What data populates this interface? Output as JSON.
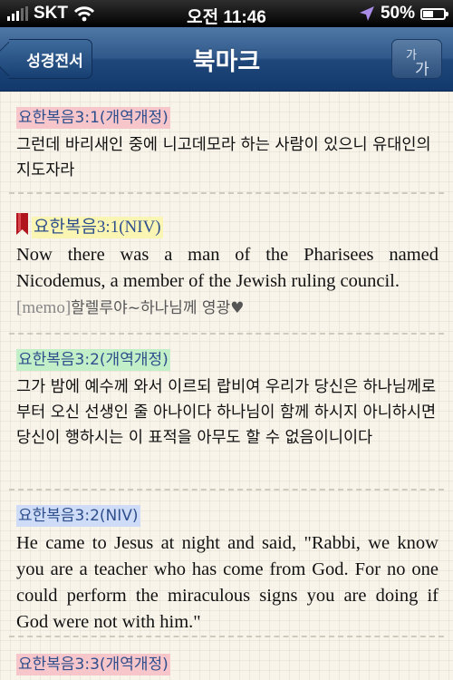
{
  "status_bar": {
    "carrier": "SKT",
    "time": "오전 11:46",
    "battery_percent": "50%",
    "battery_level": 0.5
  },
  "nav": {
    "back_label": "성경전서",
    "title": "북마크",
    "font_size_glyph_small": "가",
    "font_size_glyph_large": "가"
  },
  "entries": [
    {
      "ref": "요한복음3:1(개역개정)",
      "highlight": "#f7c6cb",
      "text": "그런데 바리새인 중에 니고데모라 하는 사람이 있으니 유대인의 지도자라"
    },
    {
      "ref": "요한복음3:1(NIV)",
      "highlight": "#fbf5b4",
      "bookmarked": true,
      "text": "Now there was a man of the Pharisees named Nicodemus, a member of the Jewish ruling council.",
      "memo_tag": "[memo]",
      "memo": "할렐루야~하나님께 영광♥"
    },
    {
      "ref": "요한복음3:2(개역개정)",
      "highlight": "#c2efc8",
      "text": "그가 밤에 예수께 와서 이르되 랍비여 우리가 당신은 하나님께로부터 오신 선생인 줄 아나이다 하나님이 함께 하시지 아니하시면 당신이 행하시는 이 표적을 아무도 할 수 없음이니이다"
    },
    {
      "ref": "요한복음3:2(NIV)",
      "highlight": "#cfdcf7",
      "text": "He came to Jesus at night and said, \"Rabbi, we know you are a teacher who has come from God. For no one could perform the miraculous signs you are doing if God were not with him.\""
    },
    {
      "ref": "요한복음3:3(개역개정)",
      "highlight": "#f7c6cb"
    }
  ],
  "colors": {
    "nav_blue": "#1f477a",
    "ref_text": "#2e4f8c",
    "bookmark_red": "#b0141c"
  }
}
